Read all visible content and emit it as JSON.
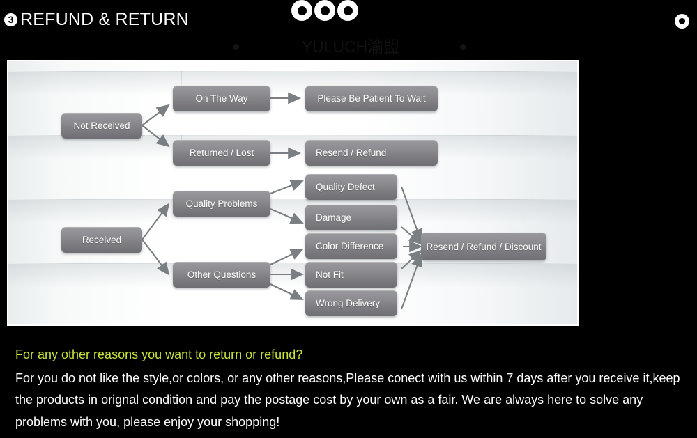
{
  "header": {
    "step_number": "3",
    "title": "REFUND & RETURN",
    "decor_dots_icon": "circle-ring-icon",
    "right_dot_icon": "circle-ring-icon"
  },
  "brand": {
    "name": "YULUCH渝盟",
    "left_bullet_icon": "bullet-dot-icon",
    "right_bullet_icon": "bullet-dot-icon"
  },
  "flowchart": {
    "nodes": {
      "not_received": "Not Received",
      "received": "Received",
      "on_the_way": "On The Way",
      "returned_lost": "Returned / Lost",
      "quality_problems": "Quality Problems",
      "other_questions": "Other Questions",
      "please_wait": "Please Be Patient To Wait",
      "resend_refund": "Resend / Refund",
      "quality_defect": "Quality Defect",
      "damage": "Damage",
      "color_difference": "Color Difference",
      "not_fit": "Not Fit",
      "wrong_delivery": "Wrong Delivery",
      "resend_refund_discount": "Resend / Refund / Discount"
    }
  },
  "footer": {
    "question": "For any other reasons you want to return or refund?",
    "body": "For you do not like the style,or colors, or any other reasons,Please conect with us within 7 days after you receive it,keep the products in orignal condition and pay the postage cost by your own as a fair. We are always here to solve any problems with you, please enjoy your shopping!"
  },
  "colors": {
    "background": "#000000",
    "accent_text": "#c8e33c",
    "box_fill": "#8d8d91",
    "panel_bg": "#ffffff"
  }
}
